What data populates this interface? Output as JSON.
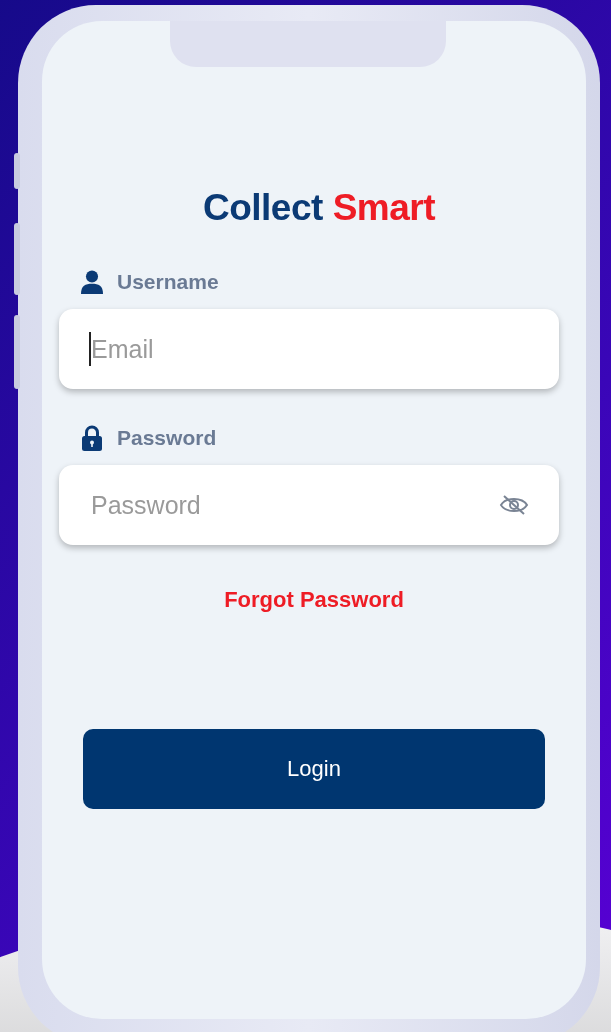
{
  "title": {
    "first": "Collect",
    "second": "Smart"
  },
  "fields": [
    {
      "kind": "user",
      "label": "Username",
      "placeholder": "Email",
      "focused": true
    },
    {
      "kind": "password",
      "label": "Password",
      "placeholder": "Password",
      "focused": false
    }
  ],
  "forgot_link": "Forgot Password",
  "login_button": "Login"
}
